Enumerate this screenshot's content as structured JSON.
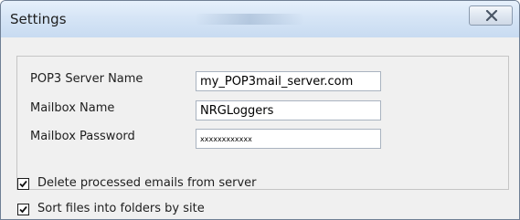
{
  "window": {
    "title": "Settings",
    "close_icon": "close-icon"
  },
  "fields": [
    {
      "label": "POP3 Server Name",
      "value": "my_POP3mail_server.com"
    },
    {
      "label": "Mailbox Name",
      "value": "NRGLoggers"
    },
    {
      "label": "Mailbox Password",
      "value": "xxxxxxxxxxxx"
    }
  ],
  "options": [
    {
      "label": "Delete processed emails from server",
      "checked": true
    },
    {
      "label": "Sort files into folders by site",
      "checked": true
    }
  ],
  "colors": {
    "title_bar": "#d6e5f6",
    "window_bg": "#f0f0f0",
    "input_border": "#a9b3c0"
  }
}
